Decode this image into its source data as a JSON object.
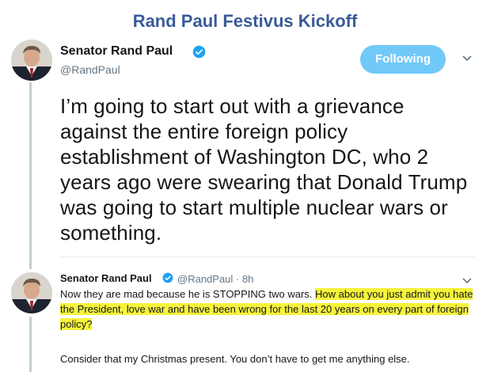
{
  "header": {
    "title": "Rand Paul Festivus Kickoff"
  },
  "main_tweet": {
    "author_name": "Senator Rand Paul",
    "handle": "@RandPaul",
    "follow_label": "Following",
    "text": "I’m going to start out with a grievance against the entire foreign policy establishment of Washington DC, who 2 years ago were swearing that Donald Trump was going to start multiple nuclear wars or something."
  },
  "reply_tweet": {
    "author_name": "Senator Rand Paul",
    "meta": "@RandPaul · 8h",
    "text_plain": "Now they are mad because he is STOPPING two wars. ",
    "text_highlight": "How about you just admit you hate the President, love war and have been wrong for the last 20 years on every part of foreign policy?",
    "text_second": "Consider that my Christmas present. You don’t have to get me anything else."
  },
  "colors": {
    "title": "#3b5a9a",
    "follow_button": "#71c9f8",
    "verified": "#1da1f2",
    "highlight": "#f6f33b"
  },
  "icons": {
    "verified": "verified-badge-icon",
    "chevron": "chevron-down-icon"
  }
}
